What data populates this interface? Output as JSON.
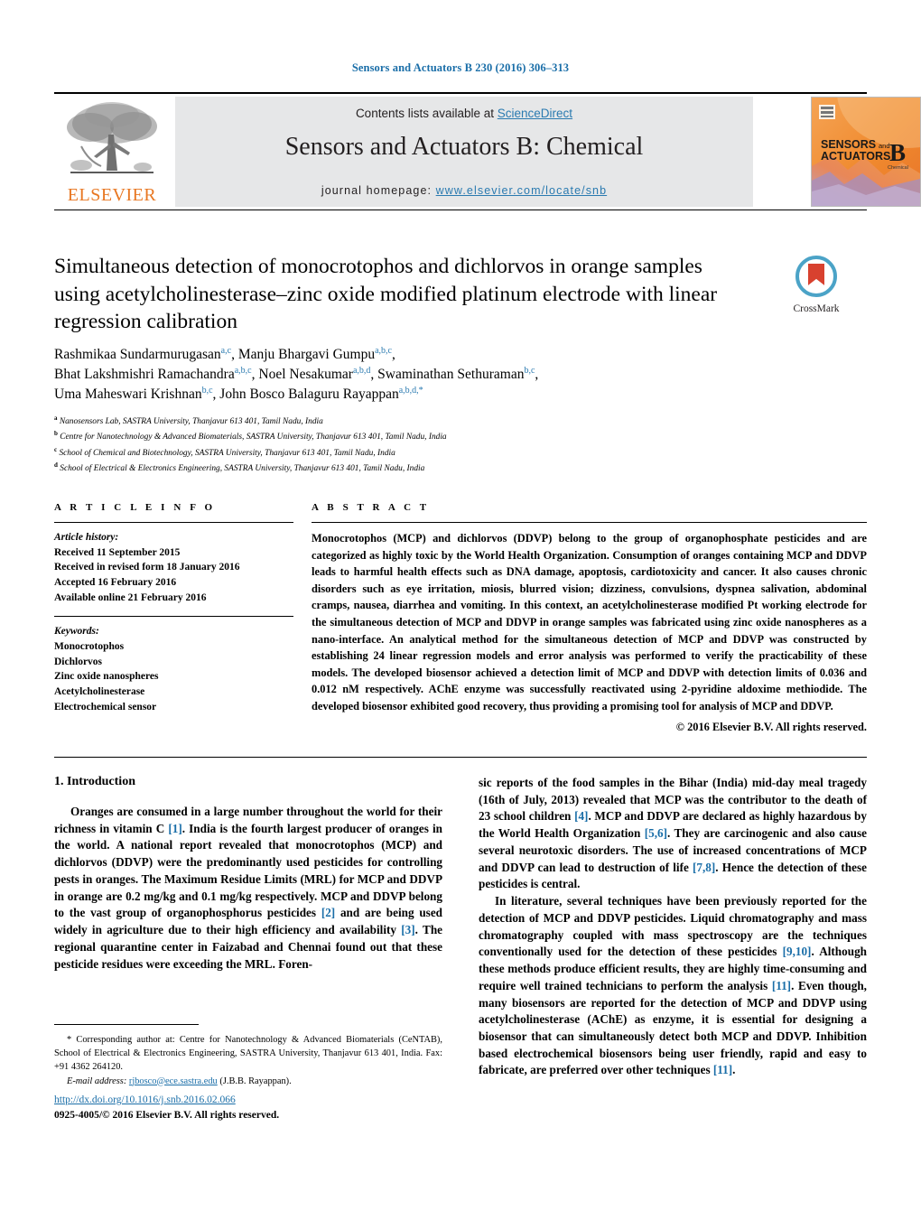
{
  "running_head": "Sensors and Actuators B 230 (2016) 306–313",
  "masthead": {
    "contents_prefix": "Contents lists available at ",
    "sciencedirect": "ScienceDirect",
    "journal_title": "Sensors and Actuators B: Chemical",
    "homepage_prefix": "journal homepage: ",
    "homepage_url": "www.elsevier.com/locate/snb",
    "publisher": "ELSEVIER",
    "cover_line1": "SENSORS",
    "cover_and": "and",
    "cover_line2": "ACTUATORS",
    "cover_letter": "B",
    "cover_sub": "Chemical",
    "link_color": "#2a7ab0",
    "elsevier_orange": "#E87722",
    "band_color": "#e6e7e8"
  },
  "crossmark": {
    "label": "CrossMark",
    "ring_color": "#4ba3c7",
    "flag_color": "#d8412f"
  },
  "title": "Simultaneous detection of monocrotophos and dichlorvos in orange samples using acetylcholinesterase–zinc oxide modified platinum electrode with linear regression calibration",
  "authors": [
    {
      "name": "Rashmikaa Sundarmurugasan",
      "marks": "a,c",
      "sep": ", "
    },
    {
      "name": "Manju Bhargavi Gumpu",
      "marks": "a,b,c",
      "sep": ","
    },
    {
      "name": "Bhat Lakshmishri Ramachandra",
      "marks": "a,b,c",
      "sep": ", "
    },
    {
      "name": "Noel Nesakumar",
      "marks": "a,b,d",
      "sep": ", "
    },
    {
      "name": "Swaminathan Sethuraman",
      "marks": "b,c",
      "sep": ","
    },
    {
      "name": "Uma Maheswari Krishnan",
      "marks": "b,c",
      "sep": ", "
    },
    {
      "name": "John Bosco Balaguru Rayappan",
      "marks": "a,b,d,*",
      "sep": ""
    }
  ],
  "affiliations": [
    {
      "mark": "a",
      "text": "Nanosensors Lab, SASTRA University, Thanjavur 613 401, Tamil Nadu, India"
    },
    {
      "mark": "b",
      "text": "Centre for Nanotechnology & Advanced Biomaterials, SASTRA University, Thanjavur 613 401, Tamil Nadu, India"
    },
    {
      "mark": "c",
      "text": "School of Chemical and Biotechnology, SASTRA University, Thanjavur 613 401, Tamil Nadu, India"
    },
    {
      "mark": "d",
      "text": "School of Electrical & Electronics Engineering, SASTRA University, Thanjavur 613 401, Tamil Nadu, India"
    }
  ],
  "article_info": {
    "heading": "A R T I C L E   I N F O",
    "history_label": "Article history:",
    "history": [
      "Received 11 September 2015",
      "Received in revised form 18 January 2016",
      "Accepted 16 February 2016",
      "Available online 21 February 2016"
    ],
    "keywords_label": "Keywords:",
    "keywords": [
      "Monocrotophos",
      "Dichlorvos",
      "Zinc oxide nanospheres",
      "Acetylcholinesterase",
      "Electrochemical sensor"
    ]
  },
  "abstract": {
    "heading": "A B S T R A C T",
    "text": "Monocrotophos (MCP) and dichlorvos (DDVP) belong to the group of organophosphate pesticides and are categorized as highly toxic by the World Health Organization. Consumption of oranges containing MCP and DDVP leads to harmful health effects such as DNA damage, apoptosis, cardiotoxicity and cancer. It also causes chronic disorders such as eye irritation, miosis, blurred vision; dizziness, convulsions, dyspnea salivation, abdominal cramps, nausea, diarrhea and vomiting. In this context, an acetylcholinesterase modified Pt working electrode for the simultaneous detection of MCP and DDVP in orange samples was fabricated using zinc oxide nanospheres as a nano-interface. An analytical method for the simultaneous detection of MCP and DDVP was constructed by establishing 24 linear regression models and error analysis was performed to verify the practicability of these models. The developed biosensor achieved a detection limit of MCP and DDVP with detection limits of 0.036 and 0.012 nM respectively. AChE enzyme was successfully reactivated using 2-pyridine aldoxime methiodide. The developed biosensor exhibited good recovery, thus providing a promising tool for analysis of MCP and DDVP.",
    "copyright": "© 2016 Elsevier B.V. All rights reserved."
  },
  "body": {
    "section_number_title": "1.  Introduction",
    "left_paragraphs": [
      "Oranges are consumed in a large number throughout the world for their richness in vitamin C [1]. India is the fourth largest producer of oranges in the world. A national report revealed that monocrotophos (MCP) and dichlorvos (DDVP) were the predominantly used pesticides for controlling pests in oranges. The Maximum Residue Limits (MRL) for MCP and DDVP in orange are 0.2 mg/kg and 0.1 mg/kg respectively. MCP and DDVP belong to the vast group of organophosphorus pesticides [2] and are being used widely in agriculture due to their high efficiency and availability [3]. The regional quarantine center in Faizabad and Chennai found out that these pesticide residues were exceeding the MRL. Foren-"
    ],
    "right_paragraphs": [
      "sic reports of the food samples in the Bihar (India) mid-day meal tragedy (16th of July, 2013) revealed that MCP was the contributor to the death of 23 school children [4]. MCP and DDVP are declared as highly hazardous by the World Health Organization [5,6]. They are carcinogenic and also cause several neurotoxic disorders. The use of increased concentrations of MCP and DDVP can lead to destruction of life [7,8]. Hence the detection of these pesticides is central.",
      "In literature, several techniques have been previously reported for the detection of MCP and DDVP pesticides. Liquid chromatography and mass chromatography coupled with mass spectroscopy are the techniques conventionally used for the detection of these pesticides [9,10]. Although these methods produce efficient results, they are highly time-consuming and require well trained technicians to perform the analysis [11]. Even though, many biosensors are reported for the detection of MCP and DDVP using acetylcholinesterase (AChE) as enzyme, it is essential for designing a biosensor that can simultaneously detect both MCP and DDVP. Inhibition based electrochemical biosensors being user friendly, rapid and easy to fabricate, are preferred over other techniques [11]."
    ]
  },
  "footnote": {
    "corresponding": "* Corresponding author at: Centre for Nanotechnology & Advanced Biomaterials (CeNTAB), School of Electrical & Electronics Engineering, SASTRA University, Thanjavur 613 401, India. Fax: +91 4362 264120.",
    "email_label": "E-mail address:",
    "email": "rjbosco@ece.sastra.edu",
    "email_owner": "(J.B.B. Rayappan)."
  },
  "footer": {
    "doi": "http://dx.doi.org/10.1016/j.snb.2016.02.066",
    "issn": "0925-4005/© 2016 Elsevier B.V. All rights reserved."
  }
}
